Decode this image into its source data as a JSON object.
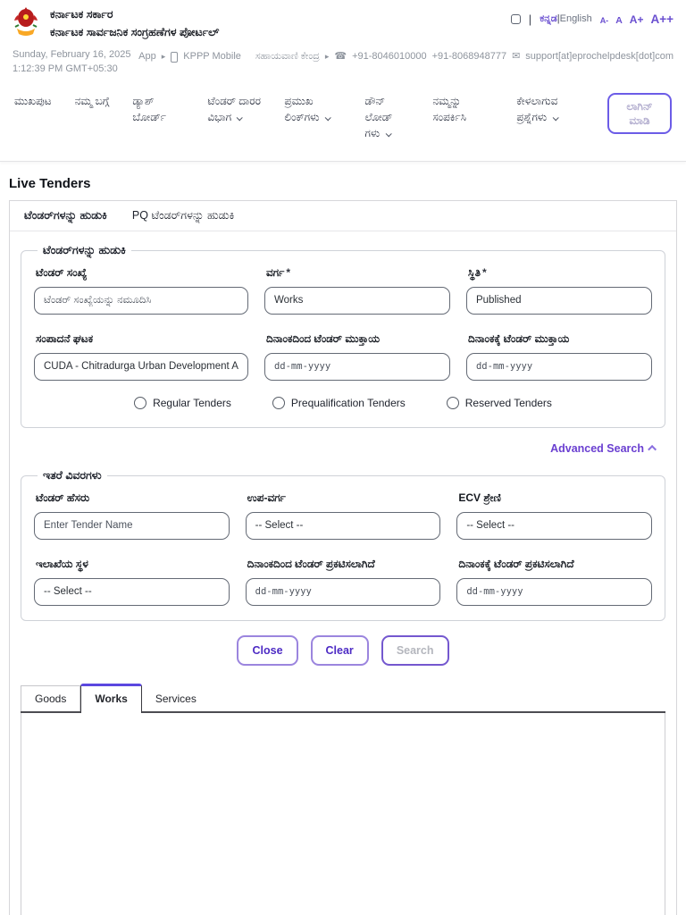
{
  "colors": {
    "accent": "#6a4fd0",
    "accent_border": "#6c5ce7",
    "tab_active_top": "#5b47e0"
  },
  "header": {
    "gov_title": "ಕರ್ನಾಟಕ ಸರ್ಕಾರ",
    "portal_title": "ಕರ್ನಾಟಕ ಸಾರ್ವಜನಿಕ ಸಂಗ್ರಹಣೆಗಳ ಪೋರ್ಟಲ್",
    "lang_kannada": "ಕನ್ನಡ",
    "lang_separator": "|",
    "lang_english": "English",
    "font_controls": [
      "A-",
      "A",
      "A+",
      "A++"
    ]
  },
  "infobar": {
    "date": "Sunday, February 16, 2025",
    "time": "1:12:39 PM GMT+05:30",
    "app_label": "App",
    "app_name": "KPPP Mobile",
    "helpline_label": "ಸಹಾಯವಾಣಿ ಕೇಂದ್ರ",
    "phone_icon": "☎",
    "phone1": "+91-8046010000",
    "phone2": "+91-8068948777",
    "email_icon": "✉",
    "email": "support[at]eprochelpdesk[dot]com"
  },
  "nav": {
    "items": [
      {
        "label": "ಮುಖಪುಟ",
        "dropdown": false
      },
      {
        "label": "ನಮ್ಮ ಬಗ್ಗೆ",
        "dropdown": false
      },
      {
        "label": "ಡ್ಯಾಶ್ ಬೋರ್ಡ್",
        "dropdown": false
      },
      {
        "label": "ಟೆಂಡರ್ ದಾರರ ವಿಭಾಗ",
        "dropdown": true
      },
      {
        "label": "ಪ್ರಮುಖ ಲಿಂಕ್‌ಗಳು",
        "dropdown": true
      },
      {
        "label": "ಡೌನ್ ಲೋಡ್ ಗಳು",
        "dropdown": true
      },
      {
        "label": "ನಮ್ಮನ್ನು ಸಂಪರ್ಕಿಸಿ",
        "dropdown": false
      },
      {
        "label": "ಕೇಳಲಾಗುವ ಪ್ರಶ್ನೆಗಳು",
        "dropdown": true
      }
    ],
    "login_label": "ಲಾಗಿನ್ ಮಾಡಿ"
  },
  "page": {
    "title": "Live Tenders"
  },
  "search_tabs": [
    {
      "label": "ಟೆಂಡರ್‌ಗಳನ್ನು ಹುಡುಕಿ",
      "active": true
    },
    {
      "label": "PQ ಟೆಂಡರ್‌ಗಳನ್ನು ಹುಡುಕಿ",
      "active": false
    }
  ],
  "search_form": {
    "legend": "ಟೆಂಡರ್‌ಗಳನ್ನು ಹುಡುಕಿ",
    "required_marker": "*",
    "tender_number_label": "ಟೆಂಡರ್ ಸಂಖ್ಯೆ",
    "tender_number_placeholder": "ಟೆಂಡರ್ ಸಂಖ್ಯೆಯನ್ನು ನಮೂದಿಸಿ",
    "category_label": "ವರ್ಗ",
    "category_value": "Works",
    "status_label": "ಸ್ಥಿತಿ",
    "status_value": "Published",
    "entity_label": "ಸಂಪಾದನೆ ಘಟಕ",
    "entity_value": "CUDA - Chitradurga Urban Development A",
    "closing_from_label": "ದಿನಾಂಕದಿಂದ ಟೆಂಡರ್ ಮುಕ್ತಾಯ",
    "closing_to_label": "ದಿನಾಂಕಕ್ಕೆ ಟೆಂಡರ್ ಮುಕ್ತಾಯ",
    "date_placeholder": "dd-mm-yyyy",
    "radios": [
      "Regular Tenders",
      "Prequalification Tenders",
      "Reserved Tenders"
    ],
    "advanced_search_label": "Advanced Search"
  },
  "details_form": {
    "legend": "ಇತರೆ ವಿವರಗಳು",
    "tender_name_label": "ಟೆಂಡರ್ ಹೆಸರು",
    "tender_name_placeholder": "Enter Tender Name",
    "subcategory_label": "ಉಪ-ವರ್ಗ",
    "subcategory_value": "-- Select --",
    "ecv_label": "ECV ಶ್ರೇಣಿ",
    "ecv_value": "-- Select --",
    "dept_location_label": "ಇಲಾಖೆಯ ಸ್ಥಳ",
    "dept_location_value": "-- Select --",
    "published_from_label": "ದಿನಾಂಕದಿಂದ ಟೆಂಡರ್ ಪ್ರಕಟಿಸಲಾಗಿದೆ",
    "published_to_label": "ದಿನಾಂಕಕ್ಕೆ ಟೆಂಡರ್ ಪ್ರಕಟಿಸಲಾಗಿದೆ",
    "date_placeholder": "dd-mm-yyyy"
  },
  "actions": {
    "close_label": "Close",
    "clear_label": "Clear",
    "search_label": "Search"
  },
  "result_tabs": [
    {
      "label": "Goods",
      "active": false
    },
    {
      "label": "Works",
      "active": true
    },
    {
      "label": "Services",
      "active": false
    }
  ]
}
